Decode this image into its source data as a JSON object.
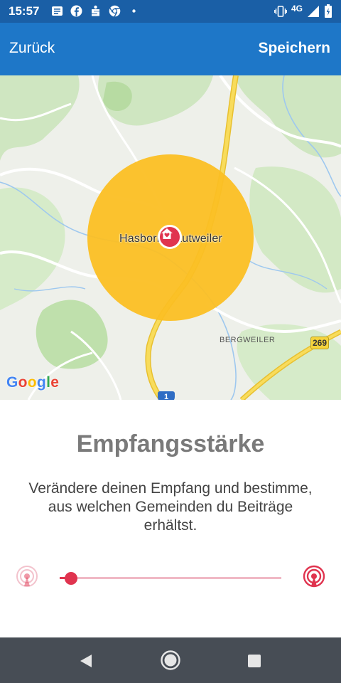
{
  "status_bar": {
    "time": "15:57",
    "network": "4G",
    "left_icons": [
      "message-icon",
      "facebook-icon",
      "sparkasse-icon",
      "chrome-icon",
      "dot-icon"
    ],
    "right_icons": [
      "vibrate-icon",
      "signal-icon",
      "battery-icon"
    ]
  },
  "app_bar": {
    "back_label": "Zurück",
    "save_label": "Speichern"
  },
  "map": {
    "town_label": "Hasborn-Dautweiler",
    "village_label": "BERGWEILER",
    "road_number": "269",
    "motorway_number": "1",
    "attribution": "Google",
    "radius_color": "#fbbf24",
    "marker_icon": "home-heart-icon"
  },
  "content": {
    "title": "Empfangsstärke",
    "description": "Verändere deinen Empfang und bestimme, aus welchen Gemeinden du Beiträge erhältst.",
    "slider": {
      "value": 0.05,
      "min_icon": "signal-weak-icon",
      "max_icon": "signal-strong-icon",
      "accent": "#e0344f",
      "track_color": "#f0b9c5"
    }
  },
  "nav_bar": {
    "buttons": [
      "back-triangle-icon",
      "home-circle-icon",
      "recents-square-icon"
    ]
  }
}
